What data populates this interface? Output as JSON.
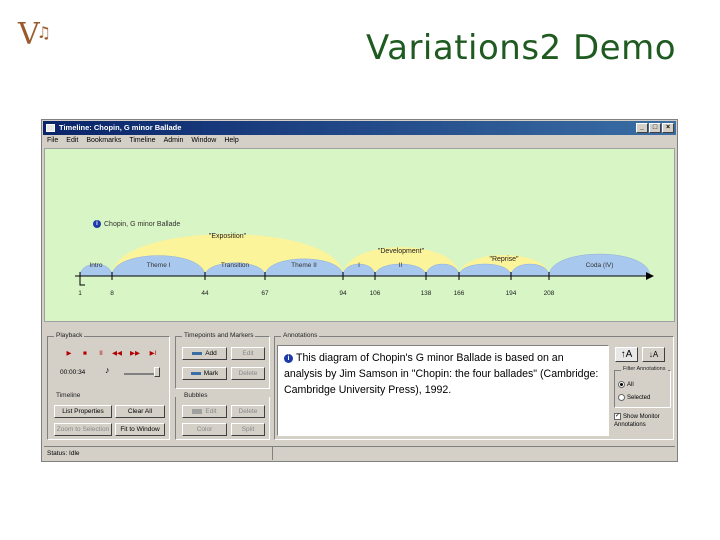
{
  "slide": {
    "logo": "V",
    "logo_note": "♫",
    "title": "Variations2 Demo"
  },
  "window": {
    "title": "Timeline: Chopin, G minor Ballade",
    "controls": [
      "_",
      "□",
      "×"
    ],
    "menu": [
      "File",
      "Edit",
      "Bookmarks",
      "Timeline",
      "Admin",
      "Window",
      "Help"
    ]
  },
  "timeline": {
    "work_title": "Chopin, G minor Ballade",
    "sections": [
      {
        "label": "Intro",
        "start": 1,
        "end": 8
      },
      {
        "label": "Theme I",
        "start": 8,
        "end": 44
      },
      {
        "label": "Transition",
        "start": 44,
        "end": 67
      },
      {
        "label": "Theme II",
        "start": 67,
        "end": 94
      },
      {
        "label": "I",
        "start": 94,
        "end": 106
      },
      {
        "label": "II",
        "start": 106,
        "end": 138
      },
      {
        "label": "",
        "start": 138,
        "end": 166
      },
      {
        "label": "",
        "start": 166,
        "end": 194
      },
      {
        "label": "",
        "start": 194,
        "end": 208
      },
      {
        "label": "Coda (IV)",
        "start": 208,
        "end": 264
      }
    ],
    "supersections": [
      {
        "label": "\"Exposition\"",
        "start": 8,
        "end": 94
      },
      {
        "label": "\"Development\"",
        "start": 94,
        "end": 166
      },
      {
        "label": "\"Reprise\"",
        "start": 166,
        "end": 208
      }
    ],
    "ticks": [
      "1",
      "8",
      "44",
      "67",
      "94",
      "106",
      "138",
      "166",
      "194",
      "208"
    ],
    "colors": {
      "background": "#d8f5c6",
      "section": "#a9c8ee",
      "supersection": "#fbf49a",
      "axis": "#000000"
    }
  },
  "playback": {
    "title": "Playback",
    "time": "00:00:34",
    "buttons": [
      "▶",
      "■",
      "II",
      "◀◀",
      "▶▶",
      "▶I"
    ]
  },
  "markers": {
    "title": "Timepoints and Markers",
    "add": "Add",
    "edit": "Edit",
    "mark": "Mark",
    "delete": "Delete"
  },
  "timeline_group": {
    "title": "Timeline",
    "list_properties": "List Properties",
    "clear_all": "Clear All",
    "zoom_to_selection": "Zoom to Selection",
    "fit_to_window": "Fit to Window"
  },
  "bubbles": {
    "title": "Bubbles",
    "edit": "Edit",
    "delete": "Delete",
    "color": "Color",
    "split": "Split"
  },
  "annotations": {
    "title": "Annotations",
    "text": "This diagram of Chopin's G minor Ballade is based on an analysis by Jim Samson in \"Chopin: the four ballades\" (Cambridge: Cambridge University Press), 1992.",
    "font_larger": "A",
    "font_smaller": "A",
    "filter_title": "Filter Annotations",
    "filter_all": "All",
    "filter_selected": "Selected",
    "show_monitor": "Show Monitor Annotations"
  },
  "status": {
    "text": "Status: Idle"
  }
}
